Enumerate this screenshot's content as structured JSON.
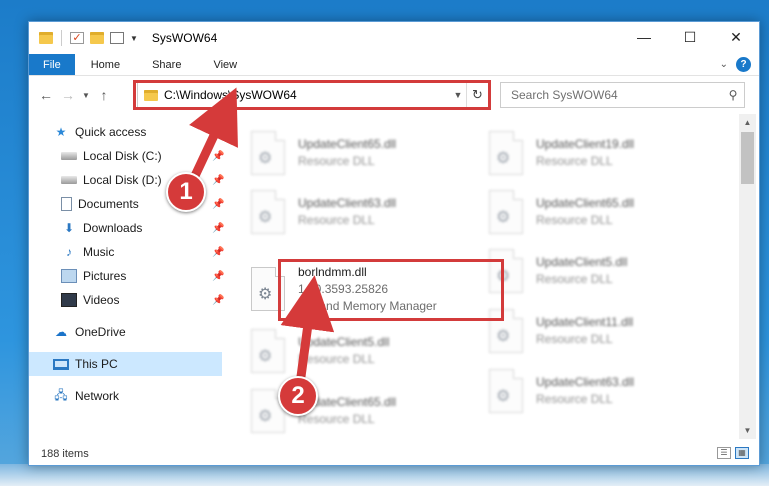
{
  "window": {
    "title": "SysWOW64",
    "buttons": {
      "minimize": "—",
      "maximize": "☐",
      "close": "✕"
    }
  },
  "ribbon": {
    "tabs": [
      {
        "label": "File"
      },
      {
        "label": "Home"
      },
      {
        "label": "Share"
      },
      {
        "label": "View"
      }
    ],
    "help": "?"
  },
  "navigation": {
    "address": "C:\\Windows\\SysWOW64",
    "search_placeholder": "Search SysWOW64"
  },
  "sidebar": {
    "items": [
      {
        "label": "Quick access",
        "icon": "star-icon"
      },
      {
        "label": "Local Disk (C:)",
        "icon": "drive-icon",
        "pinned": true
      },
      {
        "label": "Local Disk (D:)",
        "icon": "drive-icon",
        "pinned": true
      },
      {
        "label": "Documents",
        "icon": "document-icon",
        "pinned": true
      },
      {
        "label": "Downloads",
        "icon": "download-icon",
        "pinned": true
      },
      {
        "label": "Music",
        "icon": "music-icon",
        "pinned": true
      },
      {
        "label": "Pictures",
        "icon": "pictures-icon",
        "pinned": true
      },
      {
        "label": "Videos",
        "icon": "videos-icon",
        "pinned": true
      },
      {
        "label": "OneDrive",
        "icon": "cloud-icon"
      },
      {
        "label": "This PC",
        "icon": "computer-icon",
        "selected": true
      },
      {
        "label": "Network",
        "icon": "network-icon"
      }
    ]
  },
  "files": {
    "left": [
      {
        "name": "UpdateClient65.dll",
        "type": "Resource DLL"
      },
      {
        "name": "UpdateClient63.dll",
        "type": "Resource DLL"
      },
      {
        "name": "borlndmm.dll",
        "version": "14.0.3593.25826",
        "description": "Borland Memory Manager"
      },
      {
        "name": "UpdateClient5.dll",
        "type": "Resource DLL"
      },
      {
        "name": "UpdateClient65.dll",
        "type": "Resource DLL"
      }
    ],
    "right": [
      {
        "name": "UpdateClient19.dll",
        "type": "Resource DLL"
      },
      {
        "name": "UpdateClient65.dll",
        "type": "Resource DLL"
      },
      {
        "name": "UpdateClient5.dll",
        "type": "Resource DLL"
      },
      {
        "name": "UpdateClient11.dll",
        "type": "Resource DLL"
      },
      {
        "name": "UpdateClient63.dll",
        "type": "Resource DLL"
      }
    ]
  },
  "status": {
    "item_count": "188 items"
  },
  "annotations": {
    "step1": "1",
    "step2": "2",
    "color": "#d33b3b"
  }
}
